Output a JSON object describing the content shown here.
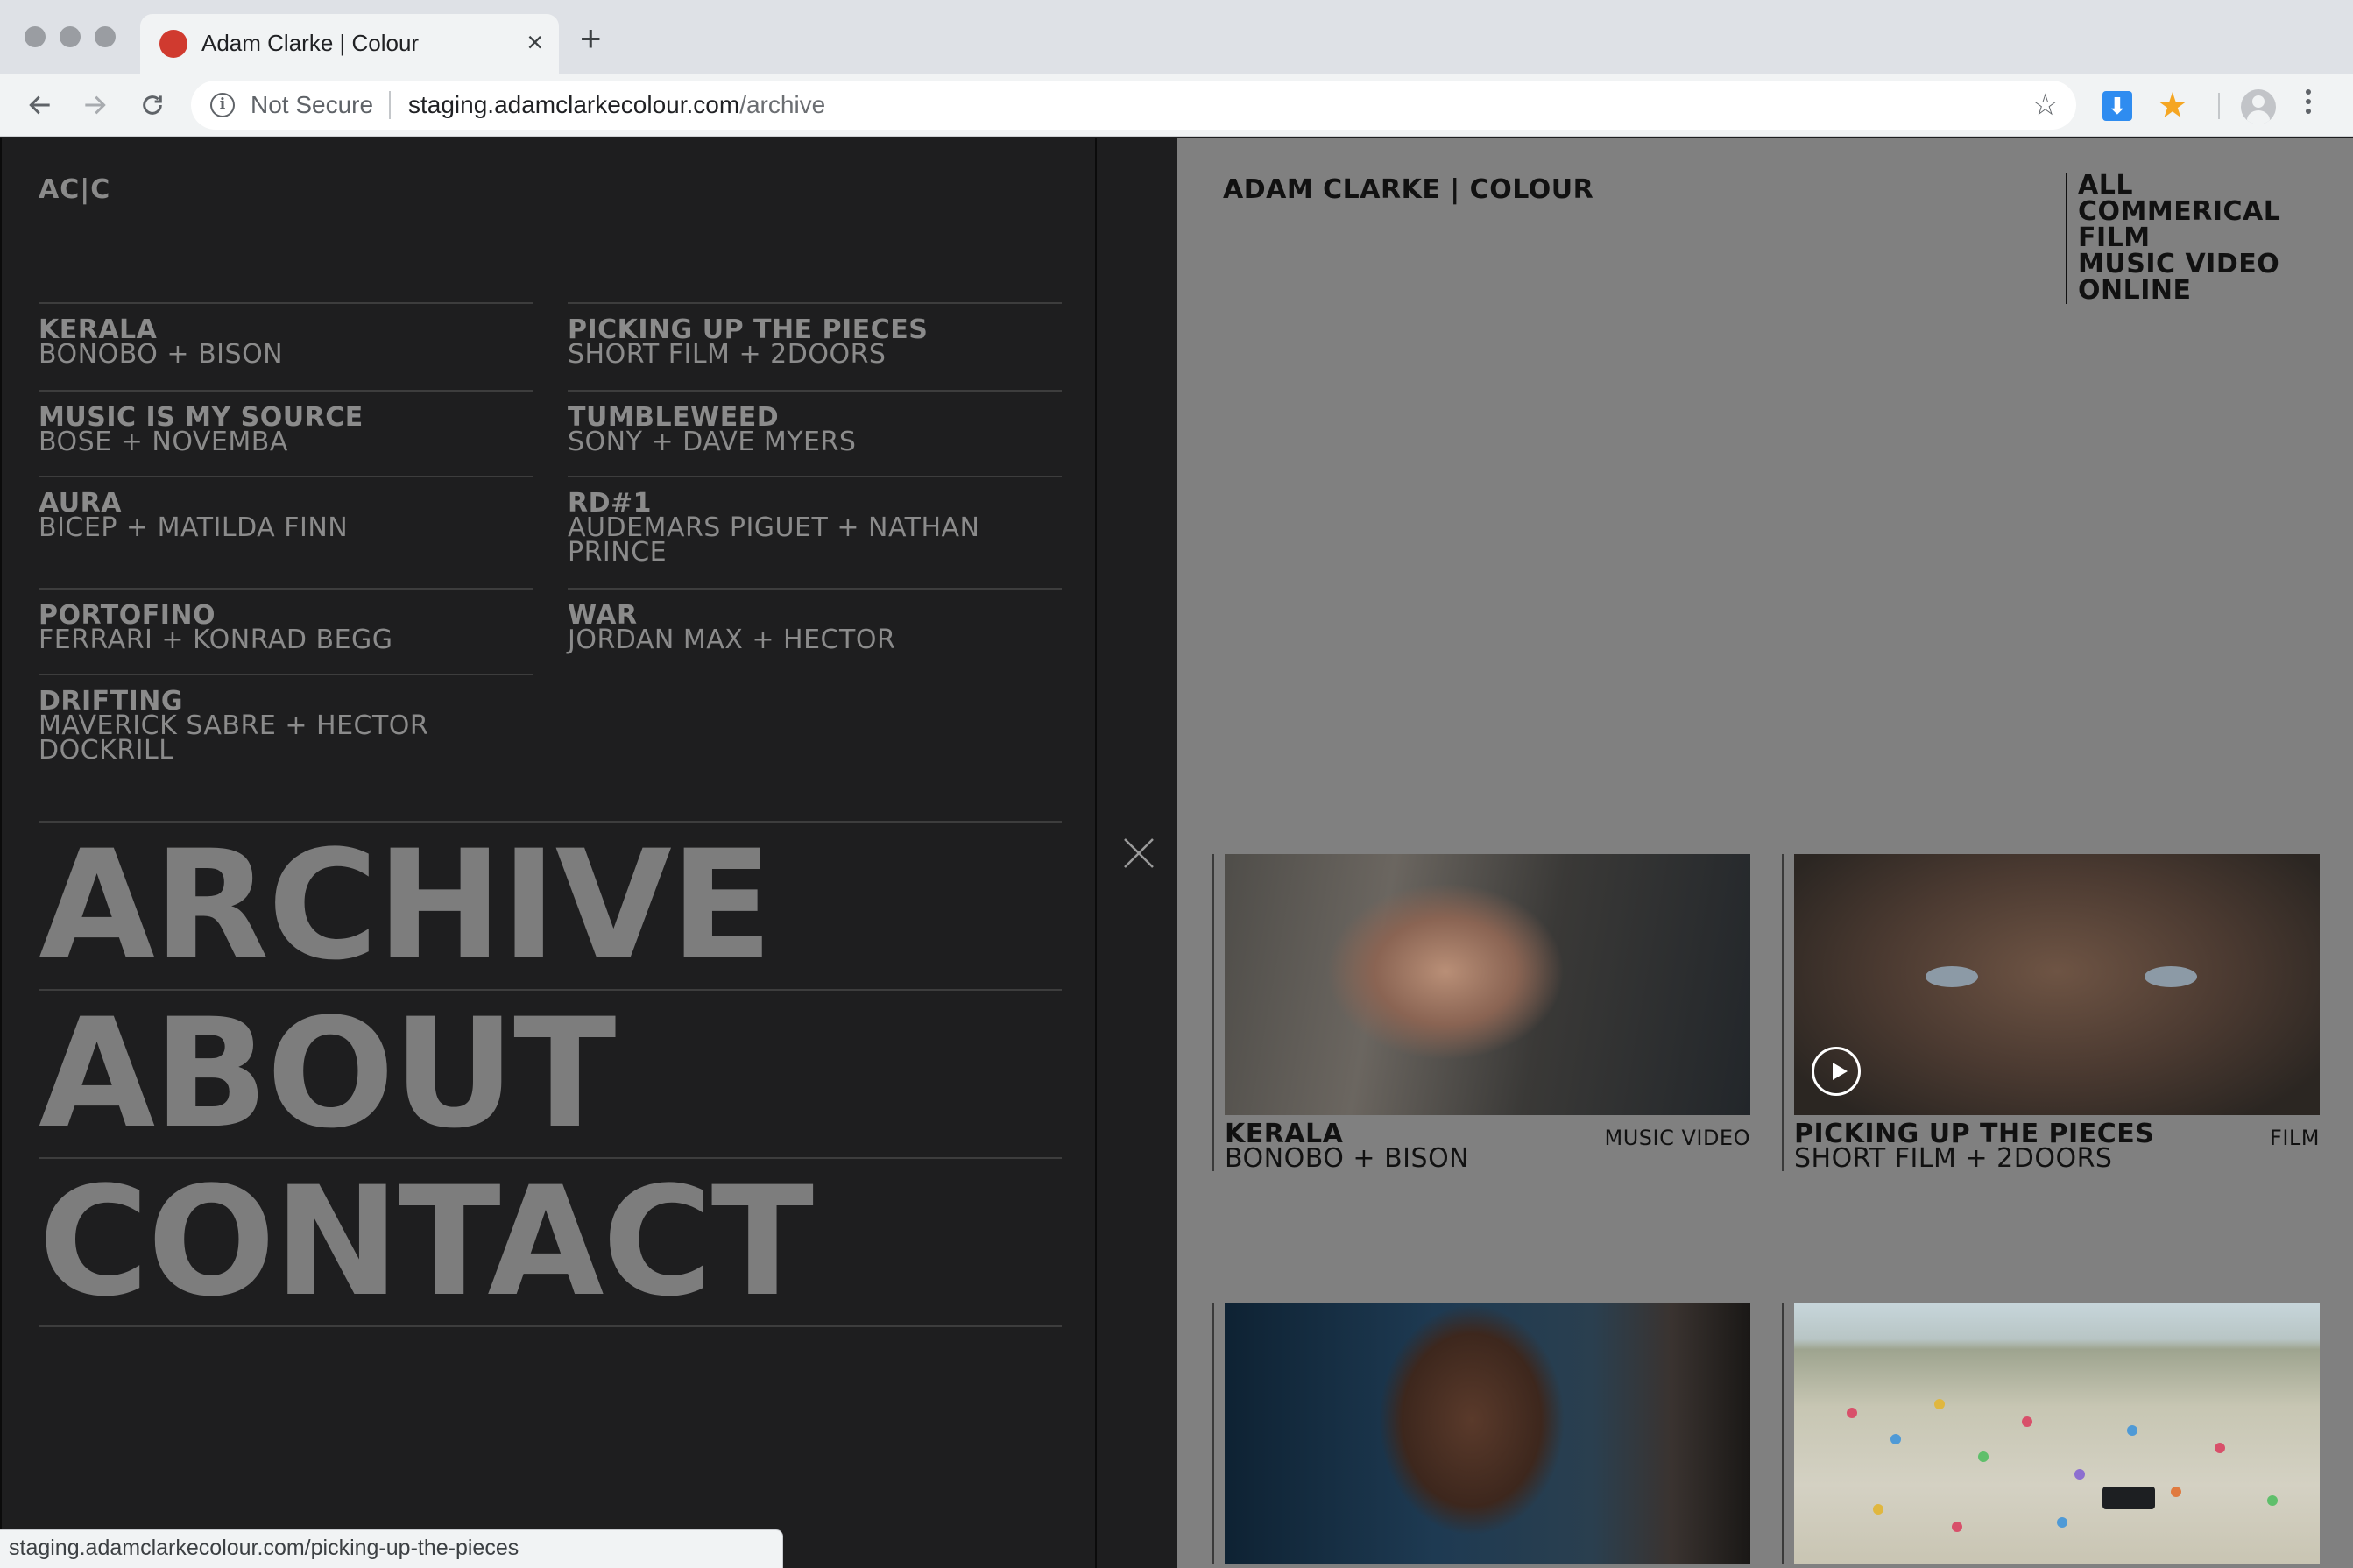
{
  "browser": {
    "tab_title": "Adam Clarke | Colour",
    "not_secure_label": "Not Secure",
    "url_host": "staging.adamclarkecolour.com",
    "url_path": "/archive",
    "status_url": "staging.adamclarkecolour.com/picking-up-the-pieces",
    "colors": {
      "favicon": "#d03a2f",
      "download_ext": "#2f8cf0",
      "star_ext": "#f5a623"
    },
    "icons": [
      "back-icon",
      "forward-icon",
      "reload-icon",
      "info-icon",
      "bookmark-star-icon",
      "download-extension-icon",
      "star-extension-icon",
      "profile-icon",
      "menu-kebab-icon",
      "close-tab-icon",
      "new-tab-icon"
    ]
  },
  "menu": {
    "logo": "AC|C",
    "projects": [
      {
        "title": "KERALA",
        "subtitle": "BONOBO + BISON"
      },
      {
        "title": "PICKING UP THE PIECES",
        "subtitle": "SHORT FILM + 2DOORS"
      },
      {
        "title": "MUSIC IS MY SOURCE",
        "subtitle": "BOSE + NOVEMBA"
      },
      {
        "title": "TUMBLEWEED",
        "subtitle": "SONY + DAVE MYERS"
      },
      {
        "title": "AURA",
        "subtitle": "BICEP + MATILDA FINN"
      },
      {
        "title": "RD#1",
        "subtitle": "AUDEMARS PIGUET + NATHAN PRINCE"
      },
      {
        "title": "PORTOFINO",
        "subtitle": "FERRARI + KONRAD BEGG"
      },
      {
        "title": "WAR",
        "subtitle": "JORDAN MAX + HECTOR"
      },
      {
        "title": "DRIFTING",
        "subtitle": "MAVERICK SABRE + HECTOR DOCKRILL"
      }
    ],
    "nav": [
      "ARCHIVE",
      "ABOUT",
      "CONTACT"
    ]
  },
  "main": {
    "site_title": "ADAM CLARKE | COLOUR",
    "filters": [
      "ALL",
      "COMMERICAL",
      "FILM",
      "MUSIC VIDEO",
      "ONLINE"
    ],
    "cards": [
      {
        "title": "KERALA",
        "subtitle": "BONOBO + BISON",
        "category": "MUSIC VIDEO"
      },
      {
        "title": "PICKING UP THE PIECES",
        "subtitle": "SHORT FILM + 2DOORS",
        "category": "FILM"
      }
    ]
  }
}
